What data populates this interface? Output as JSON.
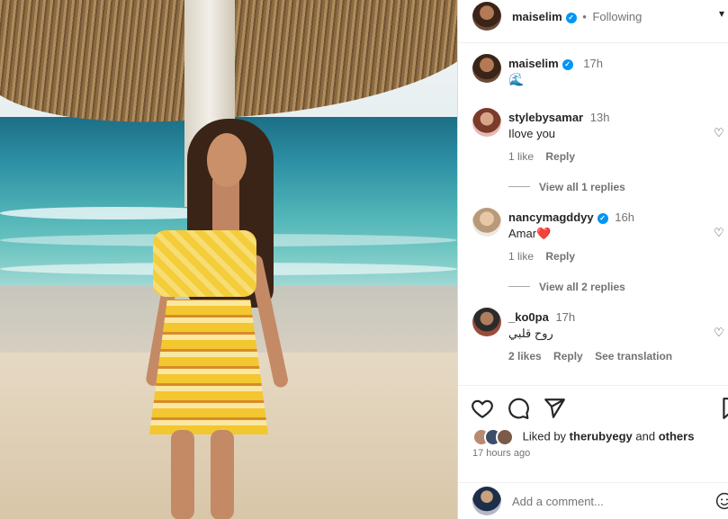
{
  "post": {
    "author": "maiselim",
    "follow_status": "Following",
    "dot": "•",
    "more_icon": "chevron-down-icon"
  },
  "caption": {
    "user": "maiselim",
    "time": "17h",
    "emoji": "🌊"
  },
  "comments": [
    {
      "user": "stylebysamar",
      "time": "13h",
      "text": "Ilove you",
      "likes": "1 like",
      "reply": "Reply",
      "view_replies": "View all 1 replies",
      "verified": false
    },
    {
      "user": "nancymagddyy",
      "time": "16h",
      "text": "Amar❤️",
      "likes": "1 like",
      "reply": "Reply",
      "view_replies": "View all 2 replies",
      "verified": true
    },
    {
      "user": "_ko0pa",
      "time": "17h",
      "text": "روح قلبي",
      "likes": "2 likes",
      "reply": "Reply",
      "see_translation": "See translation",
      "verified": false
    }
  ],
  "likes": {
    "prefix": "Liked by",
    "user": "therubyegy",
    "and": "and",
    "others": "others"
  },
  "timestamp": "17 hours ago",
  "add_comment": {
    "placeholder": "Add a comment..."
  },
  "colors": {
    "accent": "#0095f6",
    "text": "#262626",
    "muted": "#737373",
    "heart_red": "#ed1c24"
  }
}
